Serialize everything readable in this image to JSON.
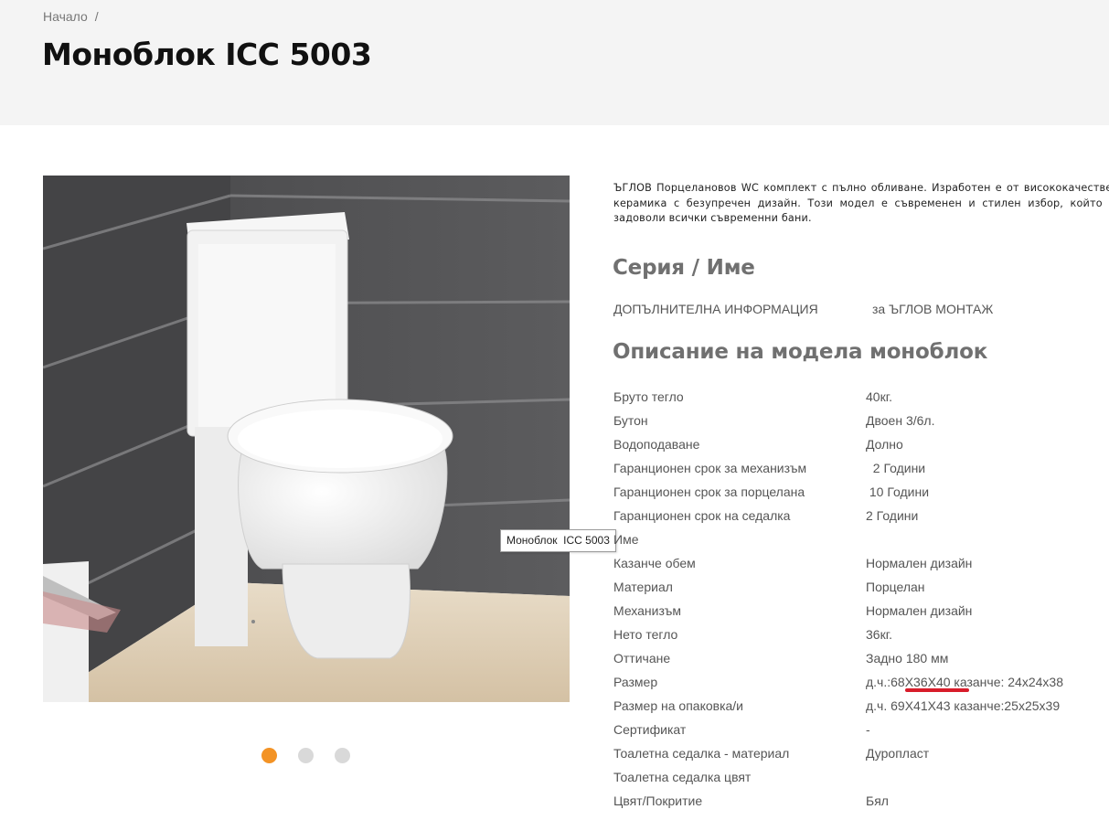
{
  "breadcrumb": {
    "home": "Начало",
    "separator": "/"
  },
  "page_title": "Моноблок ICC 5003",
  "description": "ЪГЛОВ Порцелановов WC комплект с пълно обливане. Изработен е от висококачествена керамика с безупречен дизайн.  Този модел е съвременен и стилен избор, който ще задоволи всички съвременни бани.",
  "series": {
    "title": "Серия / Име",
    "label": "ДОПЪЛНИТЕЛНА ИНФОРМАЦИЯ",
    "value": "за ЪГЛОВ МОНТАЖ"
  },
  "model": {
    "title": "Описание на модела моноблок"
  },
  "specs": [
    {
      "label": "Бруто тегло",
      "value": "40кг."
    },
    {
      "label": "Бутон",
      "value": "Двоен 3/6л."
    },
    {
      "label": "Водоподаване",
      "value": "Долно"
    },
    {
      "label": "Гаранционен срок за механизъм",
      "value": "  2 Години"
    },
    {
      "label": "Гаранционен срок за порцелана",
      "value": " 10 Години"
    },
    {
      "label": "Гаранционен срок на седалка",
      "value": "2 Години"
    },
    {
      "label": "Име",
      "value": ""
    },
    {
      "label": "Казанче обем",
      "value": "Нормален дизайн"
    },
    {
      "label": "Материал",
      "value": "Порцелан"
    },
    {
      "label": "Механизъм",
      "value": "Нормален дизайн"
    },
    {
      "label": "Нето тегло",
      "value": "36кг."
    },
    {
      "label": "Оттичане",
      "value": "Задно 180 мм"
    },
    {
      "label": "Размер",
      "value": "д.ч.:68Х36Х40 казанче: 24х24х38"
    },
    {
      "label": "Размер на опаковка/и",
      "value": "д.ч. 69Х41Х43 казанче:25х25х39"
    },
    {
      "label": "Сертификат",
      "value": "-"
    },
    {
      "label": "Тоалетна седалка - материал",
      "value": "Дуропласт"
    },
    {
      "label": "Тоалетна седалка цвят",
      "value": ""
    },
    {
      "label": "Цвят/Покритие",
      "value": "Бял"
    }
  ],
  "gallery": {
    "tooltip": "Моноблок  ICC 5003",
    "slide_count": 3,
    "active_slide": 1
  },
  "colors": {
    "accent": "#f39325",
    "dot_inactive": "#d9d9d9",
    "highlight_underline": "#d81c2a",
    "header_bg": "#f4f4f4"
  }
}
